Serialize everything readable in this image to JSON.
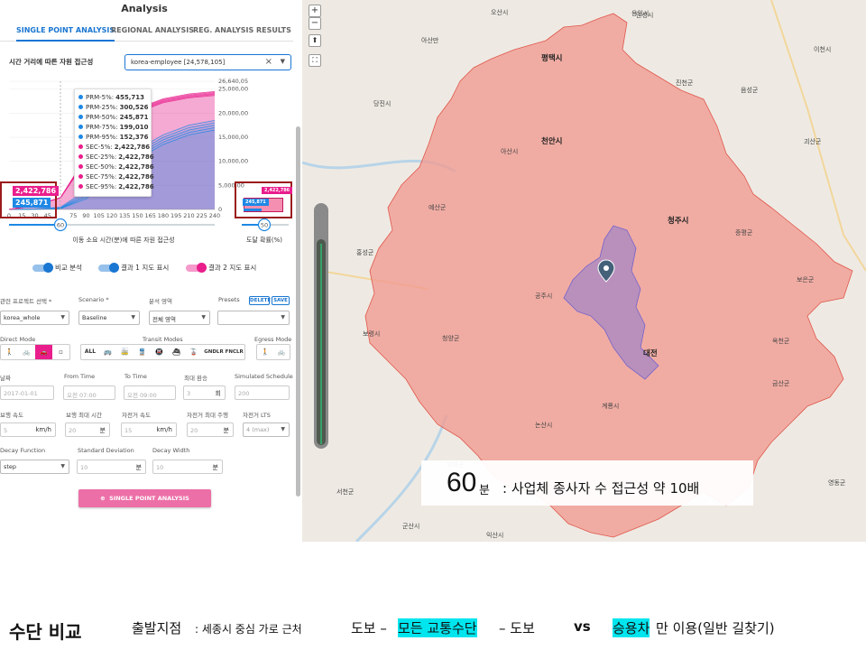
{
  "panel": {
    "title": "Analysis",
    "tabs": [
      "SINGLE POINT ANALYSIS",
      "REGIONAL ANALYSIS",
      "REG. ANALYSIS RESULTS"
    ],
    "active_tab": 0,
    "dataset_label": "시간 거리에 따른 자원 접근성",
    "dataset_value": "korea-employee [24,578,105]",
    "clear_icon": "×",
    "caret": "▼",
    "toggles": [
      {
        "label": "비교 분석",
        "color": "#1976d2",
        "on": true
      },
      {
        "label": "결과 1 지도 표시",
        "color": "#1976d2",
        "on": true
      },
      {
        "label": "결과 2 지도 표시",
        "color": "#e91e8c",
        "on": true
      }
    ],
    "form": {
      "project_label": "관련 프로젝트 선택 *",
      "project_value": "korea_whole",
      "scenario_label": "Scenario *",
      "scenario_value": "Baseline",
      "area_label": "분석 영역",
      "area_value": "전체 영역",
      "presets_label": "Presets",
      "presets_value": "",
      "delete_label": "DELETE",
      "save_label": "SAVE",
      "direct_mode_label": "Direct Mode",
      "transit_modes_label": "Transit Modes",
      "egress_mode_label": "Egress Mode",
      "transit_all": "ALL",
      "transit_extra": "GNDLR FNCLR",
      "date_label": "날짜",
      "date_value": "2017-01-01",
      "from_time_label": "From Time",
      "from_time_value": "오전 07:00",
      "to_time_label": "To Time",
      "to_time_value": "오전 09:00",
      "max_transfers_label": "최대 환승",
      "max_transfers_value": "3",
      "max_transfers_unit": "회",
      "sim_schedule_label": "Simulated Schedule",
      "sim_schedule_value": "200",
      "walk_speed_label": "보행 속도",
      "walk_speed_value": "5",
      "walk_speed_unit": "km/h",
      "walk_max_label": "보행 최대 시간",
      "walk_max_value": "20",
      "walk_max_unit": "분",
      "bike_speed_label": "자전거 속도",
      "bike_speed_value": "15",
      "bike_speed_unit": "km/h",
      "bike_max_label": "자전거 최대 주행",
      "bike_max_value": "20",
      "bike_max_unit": "분",
      "bike_lts_label": "자전거 LTS",
      "bike_lts_value": "4 (max)",
      "decay_fn_label": "Decay Function",
      "decay_fn_value": "step",
      "std_dev_label": "Standard Deviation",
      "std_dev_value": "10",
      "std_dev_unit": "분",
      "decay_width_label": "Decay Width",
      "decay_width_value": "10",
      "decay_width_unit": "분"
    },
    "run_button": "SINGLE POINT ANALYSIS",
    "run_icon": "⊕"
  },
  "chart_data": {
    "type": "area",
    "xlabel": "이동 소요 시간(분)에 따른 자원 접근성",
    "x_ticks": [
      0,
      15,
      30,
      45,
      60,
      75,
      90,
      105,
      120,
      135,
      150,
      165,
      180,
      195,
      210,
      225,
      240
    ],
    "x_tick_labels": [
      "0",
      "15",
      "30",
      "45",
      "",
      "75",
      "90",
      "105",
      "120",
      "135",
      "150",
      "165",
      "180",
      "195",
      "210",
      "225",
      "240"
    ],
    "y_tick_labels": [
      "26,640,05",
      "25,000,00",
      "20,000,00",
      "15,000,00",
      "10,000,00",
      "5,000,00",
      "0"
    ],
    "y_ticks": [
      26640050,
      25000000,
      20000000,
      15000000,
      10000000,
      5000000,
      0
    ],
    "ylim": [
      0,
      26640050
    ],
    "xlim": [
      0,
      240
    ],
    "cursor_x": 60,
    "series": [
      {
        "name": "PRM-5%",
        "color": "#1e88e5",
        "x": [
          0,
          30,
          60,
          90,
          120,
          150,
          180,
          210,
          240
        ],
        "y": [
          0,
          120000,
          455713,
          4000000,
          8500000,
          12500000,
          15500000,
          17500000,
          18500000
        ]
      },
      {
        "name": "PRM-25%",
        "color": "#1e88e5",
        "x": [
          0,
          30,
          60,
          90,
          120,
          150,
          180,
          210,
          240
        ],
        "y": [
          0,
          90000,
          300526,
          3500000,
          8000000,
          12000000,
          15000000,
          17000000,
          18000000
        ]
      },
      {
        "name": "PRM-50%",
        "color": "#1e88e5",
        "x": [
          0,
          30,
          60,
          90,
          120,
          150,
          180,
          210,
          240
        ],
        "y": [
          0,
          70000,
          245871,
          3000000,
          7500000,
          11500000,
          14500000,
          16500000,
          17500000
        ]
      },
      {
        "name": "PRM-75%",
        "color": "#1e88e5",
        "x": [
          0,
          30,
          60,
          90,
          120,
          150,
          180,
          210,
          240
        ],
        "y": [
          0,
          60000,
          199010,
          2600000,
          7000000,
          11000000,
          14000000,
          16000000,
          17000000
        ]
      },
      {
        "name": "PRM-95%",
        "color": "#1e88e5",
        "x": [
          0,
          30,
          60,
          90,
          120,
          150,
          180,
          210,
          240
        ],
        "y": [
          0,
          40000,
          152376,
          2200000,
          6500000,
          10500000,
          13500000,
          15500000,
          16500000
        ]
      },
      {
        "name": "SEC-5%",
        "color": "#e91e8c",
        "x": [
          0,
          30,
          60,
          90,
          120,
          150,
          180,
          210,
          240
        ],
        "y": [
          0,
          800000,
          2422786,
          11000000,
          17500000,
          21000000,
          23000000,
          24000000,
          24500000
        ]
      },
      {
        "name": "SEC-25%",
        "color": "#e91e8c",
        "x": [
          0,
          30,
          60,
          90,
          120,
          150,
          180,
          210,
          240
        ],
        "y": [
          0,
          800000,
          2422786,
          10800000,
          17300000,
          20800000,
          22800000,
          23800000,
          24300000
        ]
      },
      {
        "name": "SEC-50%",
        "color": "#e91e8c",
        "x": [
          0,
          30,
          60,
          90,
          120,
          150,
          180,
          210,
          240
        ],
        "y": [
          0,
          800000,
          2422786,
          10600000,
          17100000,
          20600000,
          22600000,
          23600000,
          24100000
        ]
      },
      {
        "name": "SEC-75%",
        "color": "#e91e8c",
        "x": [
          0,
          30,
          60,
          90,
          120,
          150,
          180,
          210,
          240
        ],
        "y": [
          0,
          800000,
          2422786,
          10400000,
          16900000,
          20400000,
          22400000,
          23400000,
          23900000
        ]
      },
      {
        "name": "SEC-95%",
        "color": "#e91e8c",
        "x": [
          0,
          30,
          60,
          90,
          120,
          150,
          180,
          210,
          240
        ],
        "y": [
          0,
          800000,
          2422786,
          10200000,
          16700000,
          20200000,
          22200000,
          23200000,
          23700000
        ]
      }
    ],
    "tooltip": [
      {
        "label": "PRM-5%:",
        "value": "455,713",
        "color": "#1e88e5"
      },
      {
        "label": "PRM-25%:",
        "value": "300,526",
        "color": "#1e88e5"
      },
      {
        "label": "PRM-50%:",
        "value": "245,871",
        "color": "#1e88e5"
      },
      {
        "label": "PRM-75%:",
        "value": "199,010",
        "color": "#1e88e5"
      },
      {
        "label": "PRM-95%:",
        "value": "152,376",
        "color": "#1e88e5"
      },
      {
        "label": "SEC-5%:",
        "value": "2,422,786",
        "color": "#e91e8c"
      },
      {
        "label": "SEC-25%:",
        "value": "2,422,786",
        "color": "#e91e8c"
      },
      {
        "label": "SEC-50%:",
        "value": "2,422,786",
        "color": "#e91e8c"
      },
      {
        "label": "SEC-75%:",
        "value": "2,422,786",
        "color": "#e91e8c"
      },
      {
        "label": "SEC-95%:",
        "value": "2,422,786",
        "color": "#e91e8c"
      }
    ],
    "big_values": {
      "sec": "2,422,786",
      "prm": "245,871"
    },
    "slider_value": "60",
    "side_chart": {
      "xlabel": "도달 확률(%)",
      "sec": "2,422,786",
      "prm": "245,871",
      "slider_value": "50"
    }
  },
  "map": {
    "labels": [
      {
        "text": "평택시",
        "big": true
      },
      {
        "text": "천안시",
        "big": true
      },
      {
        "text": "청주시",
        "big": true
      },
      {
        "text": "대전",
        "big": true
      },
      {
        "text": "공주시",
        "big": false
      },
      {
        "text": "논산시",
        "big": false
      },
      {
        "text": "아산시",
        "big": false
      },
      {
        "text": "당진시",
        "big": false
      },
      {
        "text": "예산군",
        "big": false
      },
      {
        "text": "보령시",
        "big": false
      },
      {
        "text": "부여군",
        "big": false
      },
      {
        "text": "서천군",
        "big": false
      },
      {
        "text": "군산시",
        "big": false
      },
      {
        "text": "익산시",
        "big": false
      },
      {
        "text": "계룡시",
        "big": false
      },
      {
        "text": "금산군",
        "big": false
      },
      {
        "text": "진천군",
        "big": false
      },
      {
        "text": "증평군",
        "big": false
      },
      {
        "text": "음성군",
        "big": false
      },
      {
        "text": "안성시",
        "big": false
      },
      {
        "text": "오산시",
        "big": false
      },
      {
        "text": "용인시",
        "big": false
      },
      {
        "text": "이천시",
        "big": false
      },
      {
        "text": "괴산군",
        "big": false
      },
      {
        "text": "보은군",
        "big": false
      },
      {
        "text": "옥천군",
        "big": false
      },
      {
        "text": "영동군",
        "big": false
      },
      {
        "text": "청양군",
        "big": false
      },
      {
        "text": "홍성군",
        "big": false
      },
      {
        "text": "아산만",
        "big": false
      }
    ],
    "zoom_in": "+",
    "zoom_out": "−",
    "caption": {
      "big": "60",
      "unit": "분",
      "text": ": 사업체 종사자 수 접근성 약 10배"
    }
  },
  "footer": {
    "title": "수단 비교",
    "origin_label": "출발지점",
    "origin_text": ": 세종시 중심 가로 근처",
    "walk1": "도보 –",
    "transit": "모든 교통수단",
    "walk2": "– 도보",
    "vs": "vs",
    "car": "승용차",
    "car_suffix": "만 이용(일반 길찾기)"
  }
}
